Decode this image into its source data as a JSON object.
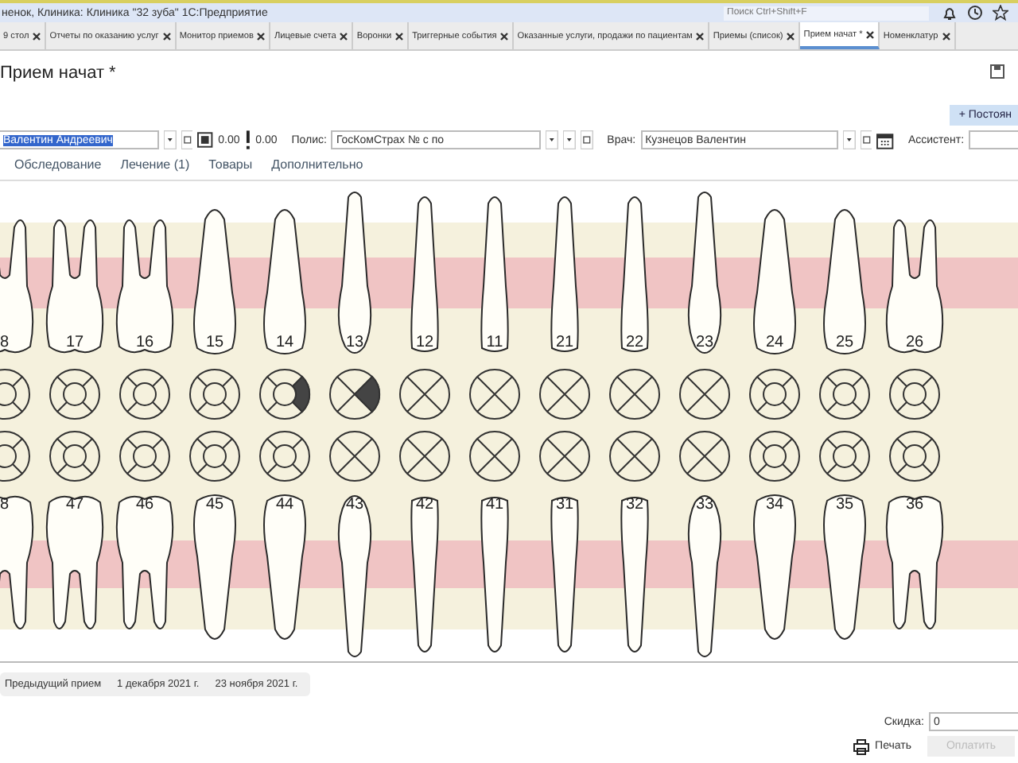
{
  "window": {
    "title": "ненок, Клиника: Клиника \"32 зуба\" 1С:Предприятие",
    "search_placeholder": "Поиск Ctrl+Shift+F"
  },
  "tabs": [
    {
      "label": "9 стол",
      "selected": false
    },
    {
      "label": "Отчеты по оказанию услуг",
      "selected": false
    },
    {
      "label": "Монитор приемов",
      "selected": false
    },
    {
      "label": "Лицевые счета",
      "selected": false
    },
    {
      "label": "Воронки",
      "selected": false
    },
    {
      "label": "Триггерные события",
      "selected": false
    },
    {
      "label": "Оказанные услуги, продажи по пациентам",
      "selected": false
    },
    {
      "label": "Приемы (список)",
      "selected": false
    },
    {
      "label": "Прием начат *",
      "selected": true
    },
    {
      "label": "Номенклатур",
      "selected": false
    }
  ],
  "form": {
    "title": "Прием начат *",
    "action_button": "+ Постоян",
    "patient": "Валентин Андреевич",
    "balance": "0.00",
    "debt": "0.00",
    "policy_label": "Полис:",
    "policy": "ГосКомСтрах № с  по",
    "doctor_label": "Врач:",
    "doctor": "Кузнецов Валентин",
    "assistant_label": "Ассистент:"
  },
  "subtabs": [
    {
      "label": "Обследование",
      "selected": false
    },
    {
      "label": "Лечение (1)",
      "selected": false
    },
    {
      "label": "Товары",
      "selected": false
    },
    {
      "label": "Дополнительно",
      "selected": false
    }
  ],
  "upper_teeth": [
    {
      "number": "8",
      "kind": "molar",
      "filled_right": false
    },
    {
      "number": "17",
      "kind": "molar",
      "filled_right": false
    },
    {
      "number": "16",
      "kind": "molar",
      "filled_right": false
    },
    {
      "number": "15",
      "kind": "premolar",
      "filled_right": false
    },
    {
      "number": "14",
      "kind": "premolar",
      "filled_right": true
    },
    {
      "number": "13",
      "kind": "canine",
      "filled_right": true
    },
    {
      "number": "12",
      "kind": "incisor",
      "filled_right": false
    },
    {
      "number": "11",
      "kind": "incisor",
      "filled_right": false
    },
    {
      "number": "21",
      "kind": "incisor",
      "filled_right": false
    },
    {
      "number": "22",
      "kind": "incisor",
      "filled_right": false
    },
    {
      "number": "23",
      "kind": "canine",
      "filled_right": false
    },
    {
      "number": "24",
      "kind": "premolar",
      "filled_right": false
    },
    {
      "number": "25",
      "kind": "premolar",
      "filled_right": false
    },
    {
      "number": "26",
      "kind": "molar",
      "filled_right": false
    }
  ],
  "lower_teeth": [
    {
      "number": "8",
      "kind": "molar",
      "filled_right": false
    },
    {
      "number": "47",
      "kind": "molar",
      "filled_right": false
    },
    {
      "number": "46",
      "kind": "molar",
      "filled_right": false
    },
    {
      "number": "45",
      "kind": "premolar",
      "filled_right": false
    },
    {
      "number": "44",
      "kind": "premolar",
      "filled_right": false
    },
    {
      "number": "43",
      "kind": "canine",
      "filled_right": false
    },
    {
      "number": "42",
      "kind": "incisor",
      "filled_right": false
    },
    {
      "number": "41",
      "kind": "incisor",
      "filled_right": false
    },
    {
      "number": "31",
      "kind": "incisor",
      "filled_right": false
    },
    {
      "number": "32",
      "kind": "incisor",
      "filled_right": false
    },
    {
      "number": "33",
      "kind": "canine",
      "filled_right": false
    },
    {
      "number": "34",
      "kind": "premolar",
      "filled_right": false
    },
    {
      "number": "35",
      "kind": "premolar",
      "filled_right": false
    },
    {
      "number": "36",
      "kind": "molar",
      "filled_right": false
    }
  ],
  "previous_visits": {
    "label": "Предыдущий прием",
    "dates": [
      "1 декабря 2021 г.",
      "23 ноября 2021 г."
    ]
  },
  "footer": {
    "discount_label": "Скидка:",
    "discount": "0",
    "print_button": "Печать",
    "pay_button": "Оплатить",
    "pay_disabled": true
  }
}
